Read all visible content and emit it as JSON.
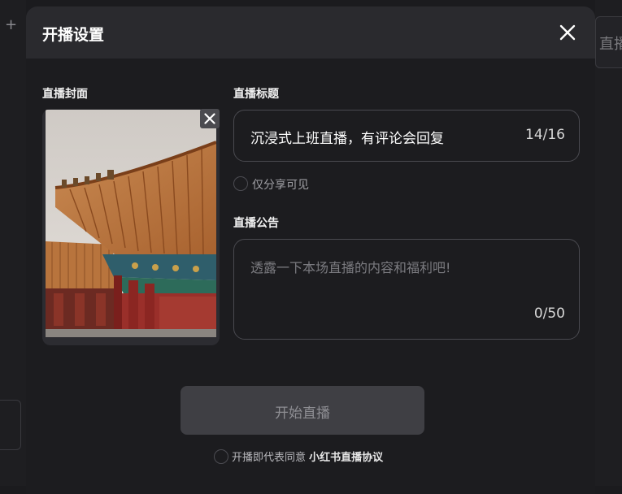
{
  "background": {
    "left_plus": "+",
    "right_button": "直播"
  },
  "modal": {
    "title": "开播设置",
    "cover": {
      "label": "直播封面"
    },
    "live_title": {
      "label": "直播标题",
      "value": "沉浸式上班直播，有评论会回复",
      "counter": "14/16"
    },
    "share_only": {
      "label": "仅分享可见"
    },
    "notice": {
      "label": "直播公告",
      "placeholder": "透露一下本场直播的内容和福利吧!",
      "counter": "0/50"
    },
    "start_button": "开始直播",
    "agreement": {
      "text": "开播即代表同意",
      "link": "小红书直播协议"
    }
  },
  "colors": {
    "modal_bg": "#1c1c1f",
    "header_bg": "#2a2a2e",
    "button_bg": "#3f3f44"
  }
}
